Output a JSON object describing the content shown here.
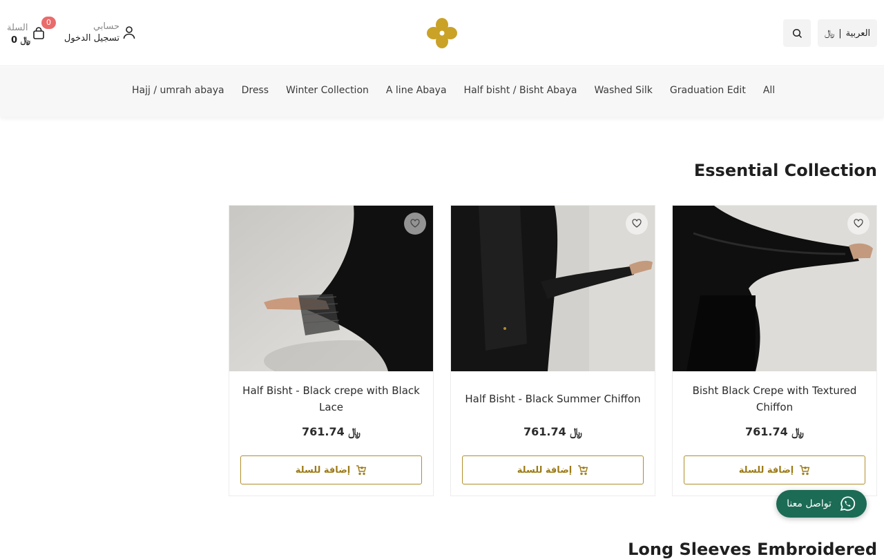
{
  "header": {
    "cart_label": "السلة",
    "cart_total": "0 ﷼",
    "cart_count": "0",
    "account_title": "حسابي",
    "account_subtitle": "تسجيل الدخول",
    "language_label": "العربية",
    "currency_symbol": "﷼"
  },
  "nav": {
    "items": [
      "Hajj / umrah abaya",
      "Dress",
      "Winter Collection",
      "A line Abaya",
      "Half bisht / Bisht Abaya",
      "Washed Silk",
      "Graduation Edit",
      "All"
    ]
  },
  "sections": [
    {
      "title": "Essential Collection",
      "products": [
        {
          "name": "Half Bisht - Black crepe with Black Lace",
          "price": "761.74 ﷼",
          "add_to_cart": "إضافة للسلة"
        },
        {
          "name": "Half Bisht - Black Summer Chiffon",
          "price": "761.74 ﷼",
          "add_to_cart": "إضافة للسلة"
        },
        {
          "name": "Bisht Black Crepe with Textured Chiffon",
          "price": "761.74 ﷼",
          "add_to_cart": "إضافة للسلة"
        }
      ]
    },
    {
      "title": "Long Sleeves Embroidered"
    }
  ],
  "chat": {
    "label": "تواصل معنا"
  },
  "colors": {
    "accent": "#b08d2a",
    "logo": "#c9a227",
    "chat_bg": "#1c6b55",
    "badge": "#ea6b6b"
  },
  "icons": [
    "cart-icon",
    "user-icon",
    "logo-icon",
    "search-icon",
    "riyal-icon",
    "heart-icon",
    "add-cart-icon",
    "whatsapp-icon"
  ]
}
